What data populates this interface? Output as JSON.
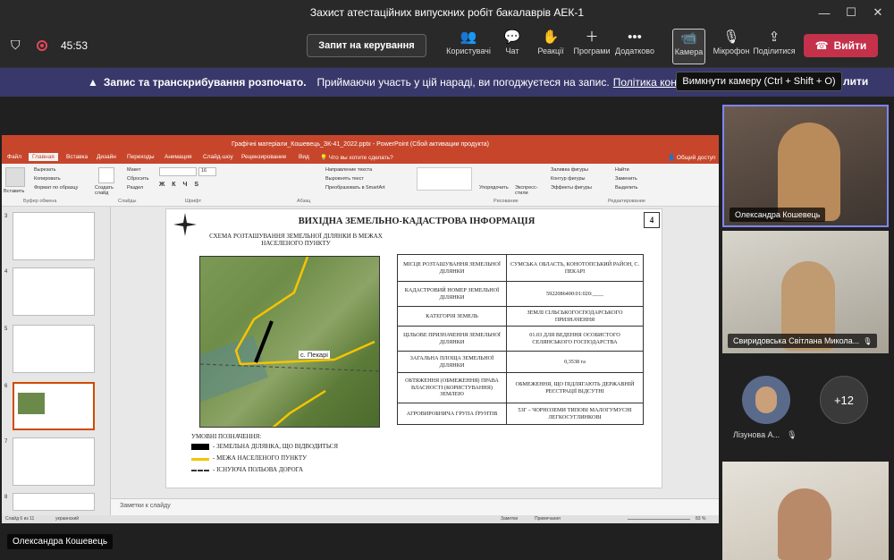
{
  "window": {
    "title": "Захист атестаційних випускних робіт бакалаврів АЕК-1"
  },
  "toolbar": {
    "timer": "45:53",
    "control_button": "Запит на керування",
    "buttons": [
      {
        "label": "Користувачі",
        "icon": "people-icon"
      },
      {
        "label": "Чат",
        "icon": "chat-icon"
      },
      {
        "label": "Реакції",
        "icon": "reactions-icon"
      },
      {
        "label": "Програми",
        "icon": "plus-icon"
      },
      {
        "label": "Додатково",
        "icon": "more-icon"
      },
      {
        "label": "Камера",
        "icon": "camera-icon"
      },
      {
        "label": "Мікрофон",
        "icon": "mic-off-icon"
      },
      {
        "label": "Поділитися",
        "icon": "share-icon"
      }
    ],
    "leave_button": "Вийти"
  },
  "banner": {
    "title": "Запис та транскрибування розпочато.",
    "text": "Приймаючи участь у цій нараді, ви погоджуєтеся на запис.",
    "link": "Політика конфіден",
    "dismiss": "лити"
  },
  "tooltip": "Вимкнути камеру (Ctrl + Shift + O)",
  "ppt": {
    "title": "Графічні матеріали_Кошевець_ЗК-41_2022.pptx - PowerPoint (Сбой активации продукта)",
    "tabs": [
      "Файл",
      "Главная",
      "Вставка",
      "Дизайн",
      "Переходы",
      "Анимация",
      "Слайд-шоу",
      "Рецензирование",
      "Вид"
    ],
    "tell_me": "Что вы хотите сделать?",
    "share": "Общий доступ",
    "ribbon": {
      "paste": "Вставить",
      "cut": "Вырезать",
      "copy": "Копировать",
      "format_painter": "Формат по образцу",
      "clipboard": "Буфер обмена",
      "new_slide": "Создать слайд",
      "layout": "Макет",
      "reset": "Сбросить",
      "section": "Раздел",
      "slides": "Слайды",
      "font": "Шрифт",
      "font_size": "16",
      "text_dir": "Направление текста",
      "align_text": "Выровнять текст",
      "smartart": "Преобразовать в SmartArt",
      "paragraph": "Абзац",
      "arrange": "Упорядочить",
      "quick_styles": "Экспресс-стили",
      "drawing": "Рисование",
      "fill": "Заливка фигуры",
      "outline": "Контур фигуры",
      "effects": "Эффекты фигуры",
      "find": "Найти",
      "replace": "Заменить",
      "select": "Выделить",
      "editing": "Редактирование"
    },
    "thumb_numbers": [
      "3",
      "4",
      "5",
      "6",
      "7",
      "8"
    ],
    "notes": "Заметки к слайду",
    "status": {
      "slide": "Слайд 6 из 11",
      "lang": "украинский",
      "notes": "Заметки",
      "comments": "Примечания",
      "zoom": "83 %"
    }
  },
  "slide": {
    "heading": "ВИХІДНА ЗЕМЕЛЬНО-КАДАСТРОВА ІНФОРМАЦІЯ",
    "number": "4",
    "scheme_title": "СХЕМА РОЗТАШУВАННЯ ЗЕМЕЛЬНОЇ ДІЛЯНКИ В МЕЖАХ НАСЕЛЕНОГО ПУНКТУ",
    "map_label": "с. Пекарі",
    "legend_title": "УМОВНІ ПОЗНАЧЕННЯ:",
    "legend": [
      {
        "text": "- ЗЕМЕЛЬНА ДІЛЯНКА, ЩО ВІДВОДИТЬСЯ",
        "color": "#000000"
      },
      {
        "text": "- МЕЖА НАСЕЛЕНОГО ПУНКТУ",
        "color": "#f5c400"
      },
      {
        "text": "- ІСНУЮЧА ПОЛЬОВА ДОРОГА",
        "color": "#333333"
      }
    ],
    "table": [
      [
        "МІСЦЕ РОЗТАШУВАННЯ ЗЕМЕЛЬНОЇ ДІЛЯНКИ",
        "СУМСЬКА ОБЛАСТЬ, КОНОТОПСЬКИЙ РАЙОН, С. ПЕКАРІ"
      ],
      [
        "КАДАСТРОВИЙ НОМЕР ЗЕМЕЛЬНОЇ ДІЛЯНКИ",
        "5922086400:01:020:____"
      ],
      [
        "КАТЕГОРІЯ ЗЕМЕЛЬ",
        "ЗЕМЛІ СІЛЬСЬКОГОСПОДАРСЬКОГО ПРИЗНАЧЕННЯ"
      ],
      [
        "ЦІЛЬОВЕ ПРИЗНАЧЕННЯ ЗЕМЕЛЬНОЇ ДІЛЯНКИ",
        "01.03 ДЛЯ ВЕДЕННЯ ОСОБИСТОГО СЕЛЯНСЬКОГО ГОСПОДАРСТВА"
      ],
      [
        "ЗАГАЛЬНА ПЛОЩА ЗЕМЕЛЬНОЇ ДІЛЯНКИ",
        "0,3538 га"
      ],
      [
        "ОБТЯЖЕННЯ (ОБМЕЖЕННЯ) ПРАВА ВЛАСНОСТІ (КОРИСТУВАННЯ) ЗЕМЛЕЮ",
        "ОБМЕЖЕННЯ, ЩО ПІДЛЯГАЮТЬ ДЕРЖАВНІЙ РЕЄСТРАЦІЇ ВІДСУТНІ"
      ],
      [
        "АГРОВИРОБНИЧА ГРУПА ҐРУНТІВ",
        "53Г – ЧОРНОЗЕМИ ТИПОВІ МАЛОГУМУСНІ ЛЕГКОСУГЛИНКОВІ"
      ]
    ]
  },
  "participants": {
    "p1": "Олександра Кошевець",
    "p2": "Свиридовська Світлана Микола...",
    "p3": "Лізунова А...",
    "more": "+12",
    "presenter": "Олександра Кошевець"
  }
}
